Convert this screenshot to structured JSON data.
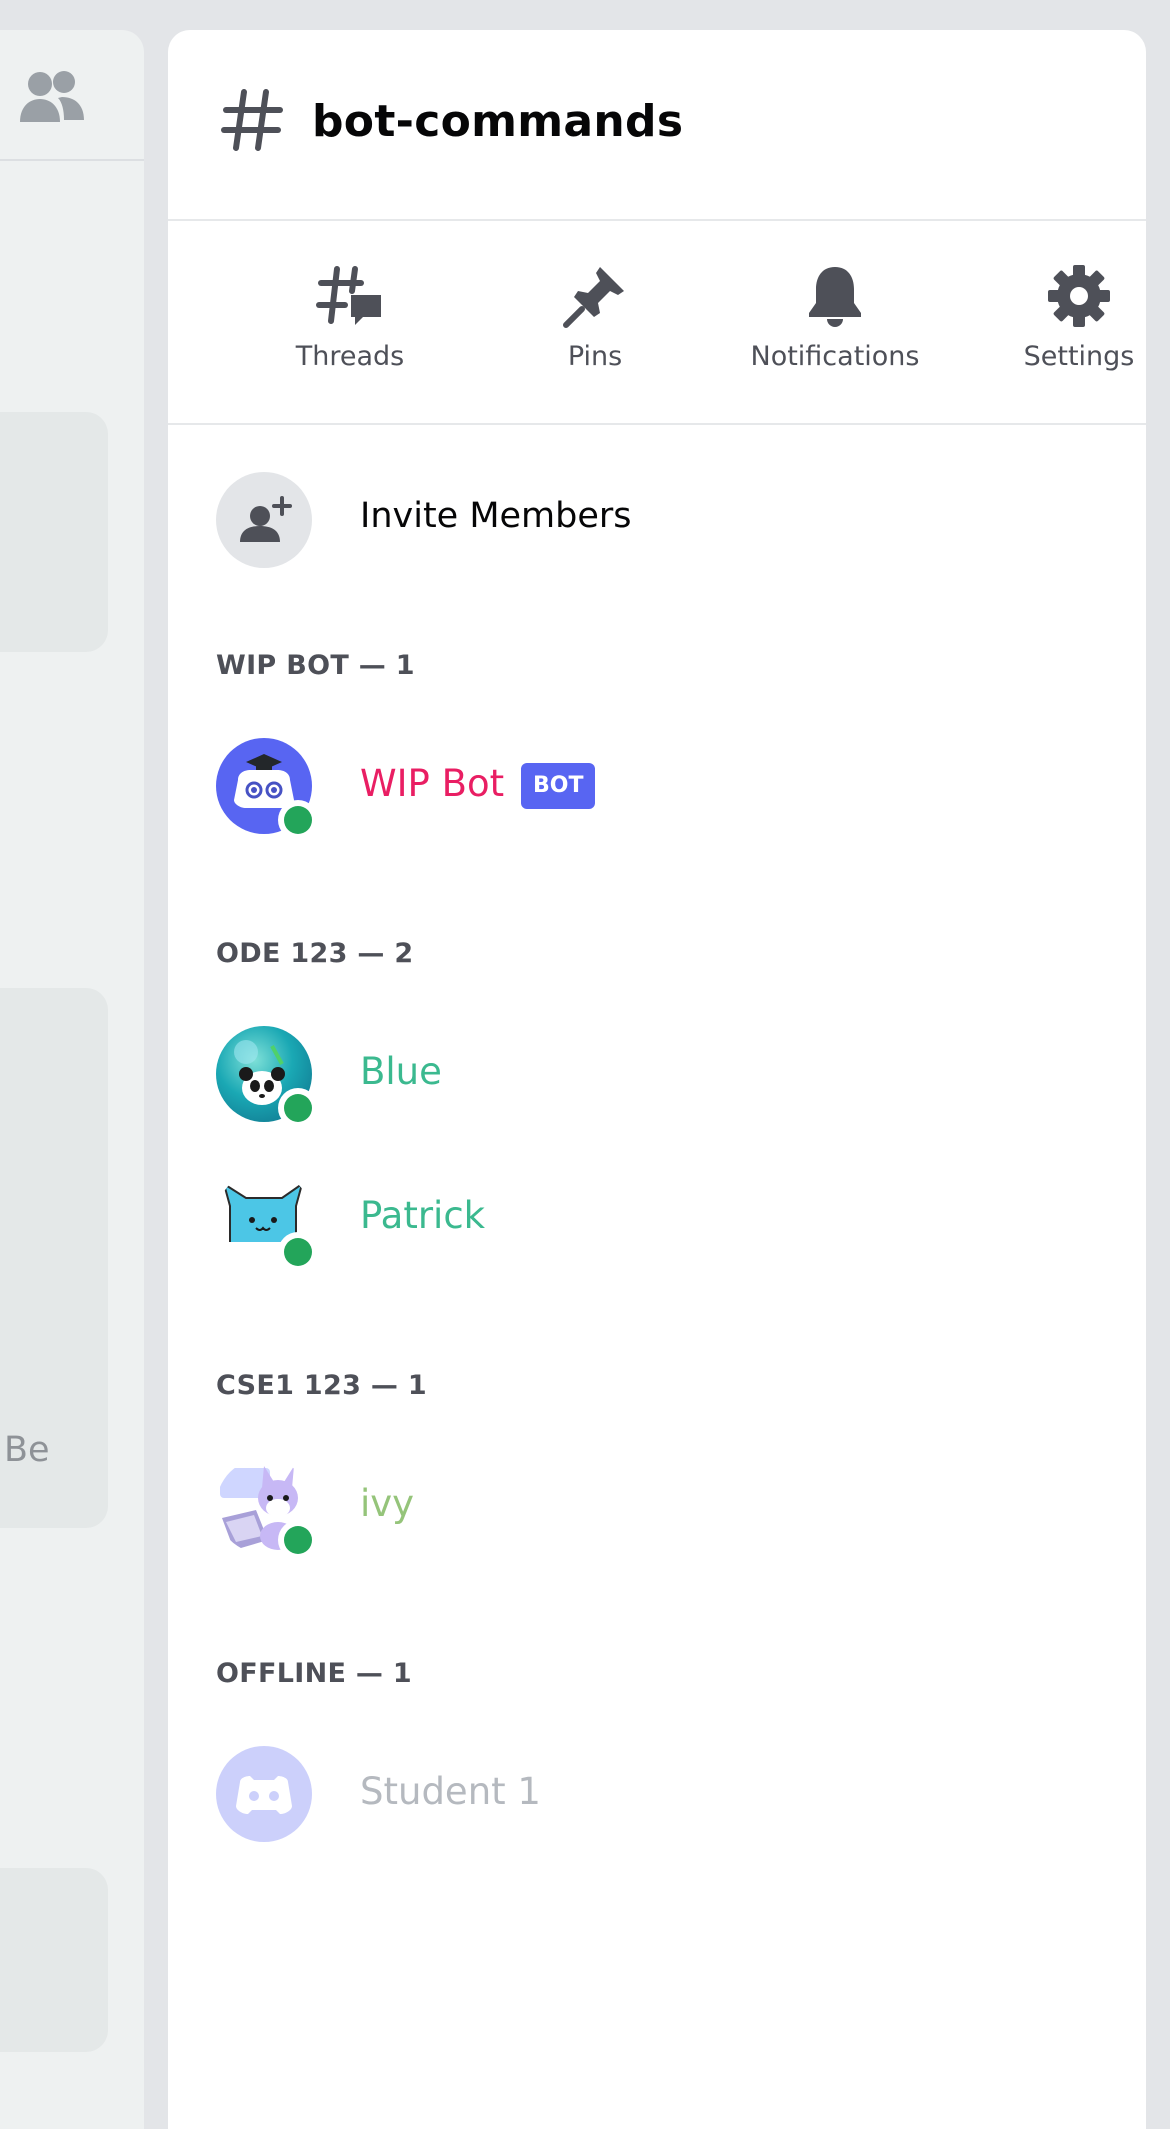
{
  "left_panel": {
    "partial_text": "Be",
    "members_icon": "members-icon"
  },
  "channel": {
    "name": "bot-commands",
    "icon": "hash-icon"
  },
  "actions": [
    {
      "label": "Threads",
      "icon": "threads-icon"
    },
    {
      "label": "Pins",
      "icon": "pin-icon"
    },
    {
      "label": "Notifications",
      "icon": "bell-icon"
    },
    {
      "label": "Settings",
      "icon": "gear-icon"
    }
  ],
  "invite": {
    "label": "Invite Members",
    "icon": "add-person-icon"
  },
  "sections": [
    {
      "title": "WIP BOT — 1",
      "members": [
        {
          "name": "WIP Bot",
          "color": "#e91e63",
          "badge": "BOT",
          "status": "online"
        }
      ]
    },
    {
      "title": "ODE 123 — 2",
      "members": [
        {
          "name": "Blue",
          "color": "#3bb98f",
          "status": "online"
        },
        {
          "name": "Patrick",
          "color": "#3bb98f",
          "status": "online"
        }
      ]
    },
    {
      "title": "CSE1 123 — 1",
      "members": [
        {
          "name": "ivy",
          "color": "#95c47a",
          "status": "online"
        }
      ]
    },
    {
      "title": "OFFLINE — 1",
      "members": [
        {
          "name": "Student 1",
          "color": "#b5b9bf",
          "status": "offline"
        }
      ]
    }
  ],
  "colors": {
    "brand": "#5865f2",
    "online": "#23a55a"
  }
}
